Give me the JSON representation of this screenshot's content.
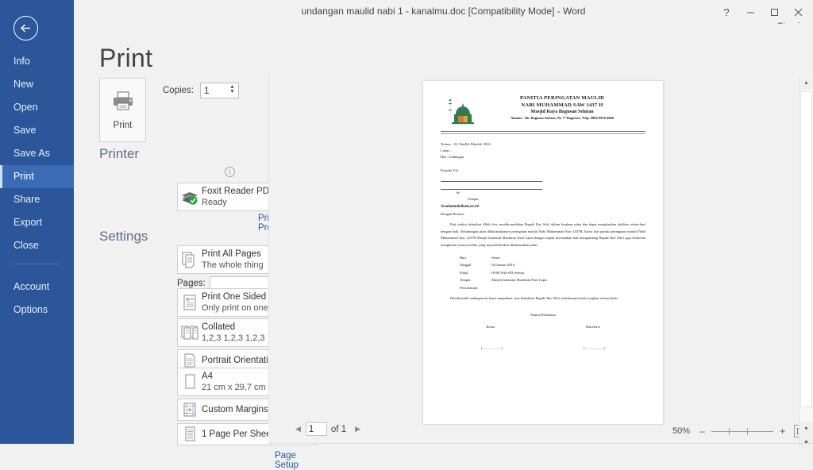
{
  "window": {
    "title": "undangan maulid nabi 1 - kanalmu.doc [Compatibility Mode] - Word",
    "help_label": "?",
    "minimize_label": "–",
    "maximize_label": "□",
    "close_label": "✕",
    "signin_label": "Sign in"
  },
  "rail": {
    "back_icon": "back-arrow-icon",
    "items": [
      {
        "label": "Info",
        "active": false
      },
      {
        "label": "New",
        "active": false
      },
      {
        "label": "Open",
        "active": false
      },
      {
        "label": "Save",
        "active": false
      },
      {
        "label": "Save As",
        "active": false
      },
      {
        "label": "Print",
        "active": true
      },
      {
        "label": "Share",
        "active": false
      },
      {
        "label": "Export",
        "active": false
      },
      {
        "label": "Close",
        "active": false
      },
      {
        "label": "Account",
        "active": false
      },
      {
        "label": "Options",
        "active": false
      }
    ],
    "accent_color": "#2b579a",
    "active_color": "#3a6bb5"
  },
  "print": {
    "heading": "Print",
    "button_label": "Print",
    "copies_label": "Copies:",
    "copies_value": "1",
    "printer_section_title": "Printer",
    "printer_name": "Foxit Reader PDF Printer",
    "printer_status": "Ready",
    "printer_properties_link": "Printer Properties",
    "settings_section_title": "Settings",
    "pages_label": "Pages:",
    "pages_value": "",
    "pages_placeholder": "",
    "page_setup_link": "Page Setup",
    "info_glyph": "i",
    "settings": [
      {
        "title": "Print All Pages",
        "subtitle": "The whole thing",
        "icon": "pages-icon"
      },
      {
        "title": "Print One Sided",
        "subtitle": "Only print on one side of th...",
        "icon": "one-sided-icon"
      },
      {
        "title": "Collated",
        "subtitle": "1,2,3   1,2,3   1,2,3",
        "icon": "collated-icon"
      },
      {
        "title": "Portrait Orientation",
        "subtitle": "",
        "icon": "orientation-icon"
      },
      {
        "title": "A4",
        "subtitle": "21 cm x 29,7 cm",
        "icon": "paper-size-icon"
      },
      {
        "title": "Custom Margins",
        "subtitle": "",
        "icon": "margins-icon"
      },
      {
        "title": "1 Page Per Sheet",
        "subtitle": "",
        "icon": "pages-per-sheet-icon"
      }
    ]
  },
  "preview": {
    "page_number": "1",
    "page_count_label": "of 1",
    "prev_glyph": "◀",
    "next_glyph": "▶",
    "zoom_percent": "50%",
    "zoom_out_glyph": "–",
    "zoom_in_glyph": "+",
    "zoom_to_page_icon": "zoom-to-page-icon"
  },
  "document": {
    "logo_icon": "mosque-logo-icon",
    "header_line1": "PANITIA PERINGATAN MAULID",
    "header_line2": "NABI MUHAMMAD SAW 1437 H",
    "header_line3": "Masjid Raya Bagusan Selatan",
    "header_line4": "Alamat : Jln. Bagusan Selatan, No 77 Bagusan  |  Telp: 0804-0918-4666",
    "nomor": "Nomor : 01/ PanPel-Maulid/ 2016",
    "lamp": "Lamp.  : _",
    "hal": "Hal      : Undangan",
    "kepada": "Kepada Yth.",
    "di": "di-",
    "tempat": "Tempat",
    "salam": "Assalamualaikum,wr,wb",
    "dengan_hormat": "Dengan Hormat,",
    "body": "Puji syukur kehadirat Allah Swt, mudah-mudahan Bapak/ Ibu/ Sdr/i  dalam keadaan sehat dan dapat menjalankan aktifitas sehari-hari dengan baik. Sehubungan akan dilaksanakanrya peringatan maulid Nabi Muhammad Saw 1437H, Kami dari panitia peringatan maulid Nabi Muhammad Saw 1437H Masjid Jamilatul Muslimin Parit Lapis,dengan segala kerendahan hati mengundang Bapak/ Ibu/ Sdr/i agar berkenan menghadiri acara tersebut yang insyaAllah akan dilaksanakan pada :",
    "details": [
      {
        "key": "Hari",
        "value": ": Senin"
      },
      {
        "key": "Tanggal",
        "value": ": 04 Januari 2016"
      },
      {
        "key": "Pukul",
        "value": ": 09.00 Wib S/D Selesai"
      },
      {
        "key": "Tempat",
        "value": ": Masjid Jamilatul Muslimin Parit Lapis"
      },
      {
        "key": "Penceramah :",
        "value": ""
      }
    ],
    "closing": "Demikianlah undangan ini kami sampaikan, atas kehadiran Bapak/ Ibu/ Sdr/i sebelumnya kami ucapkan terima kasih.",
    "committee": "Panitia Pelaksana",
    "role_left": "Ketua",
    "role_right": "Sekretaris",
    "sign_left": "(.....................)",
    "sign_right": "(.....................)"
  }
}
